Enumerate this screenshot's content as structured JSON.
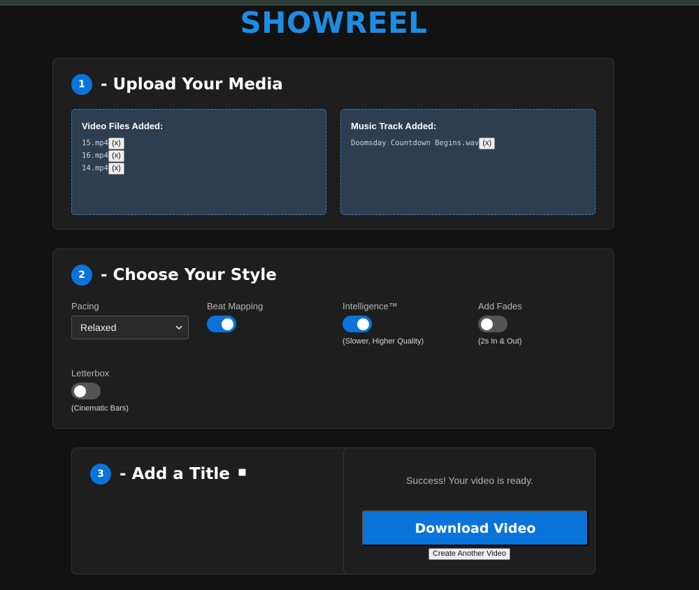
{
  "app": {
    "title": "SHOWREEL"
  },
  "upload": {
    "step_number": "1",
    "title": "- Upload Your Media",
    "video_label": "Video Files Added:",
    "videos": [
      {
        "name": "15.mp4",
        "remove": "(x)"
      },
      {
        "name": "16.mp4",
        "remove": "(x)"
      },
      {
        "name": "14.mp4",
        "remove": "(x)"
      }
    ],
    "music_label": "Music Track Added:",
    "music": {
      "name": "Doomsday Countdown Begins.wav",
      "remove": "(x)"
    }
  },
  "style": {
    "step_number": "2",
    "title": "- Choose Your Style",
    "pacing": {
      "label": "Pacing",
      "value": "Relaxed",
      "icon": "chevron-down-icon"
    },
    "beat_mapping": {
      "label": "Beat Mapping",
      "on": true
    },
    "intelligence": {
      "label": "Intelligence™",
      "on": true,
      "note": "(Slower, Higher Quality)"
    },
    "fades": {
      "label": "Add Fades",
      "on": false,
      "note": "(2s In & Out)"
    },
    "letterbox": {
      "label": "Letterbox",
      "on": false,
      "note": "(Cinematic Bars)"
    }
  },
  "title_step": {
    "step_number": "3",
    "title": "- Add a Title",
    "checked": false
  },
  "result": {
    "message": "Success! Your video is ready.",
    "download_label": "Download Video",
    "create_another_label": "Create Another Video"
  },
  "colors": {
    "accent": "#0a74da",
    "title": "#1f8ce3",
    "background": "#121212",
    "card": "#1e1e1e",
    "dropzone": "#2d3e50"
  }
}
